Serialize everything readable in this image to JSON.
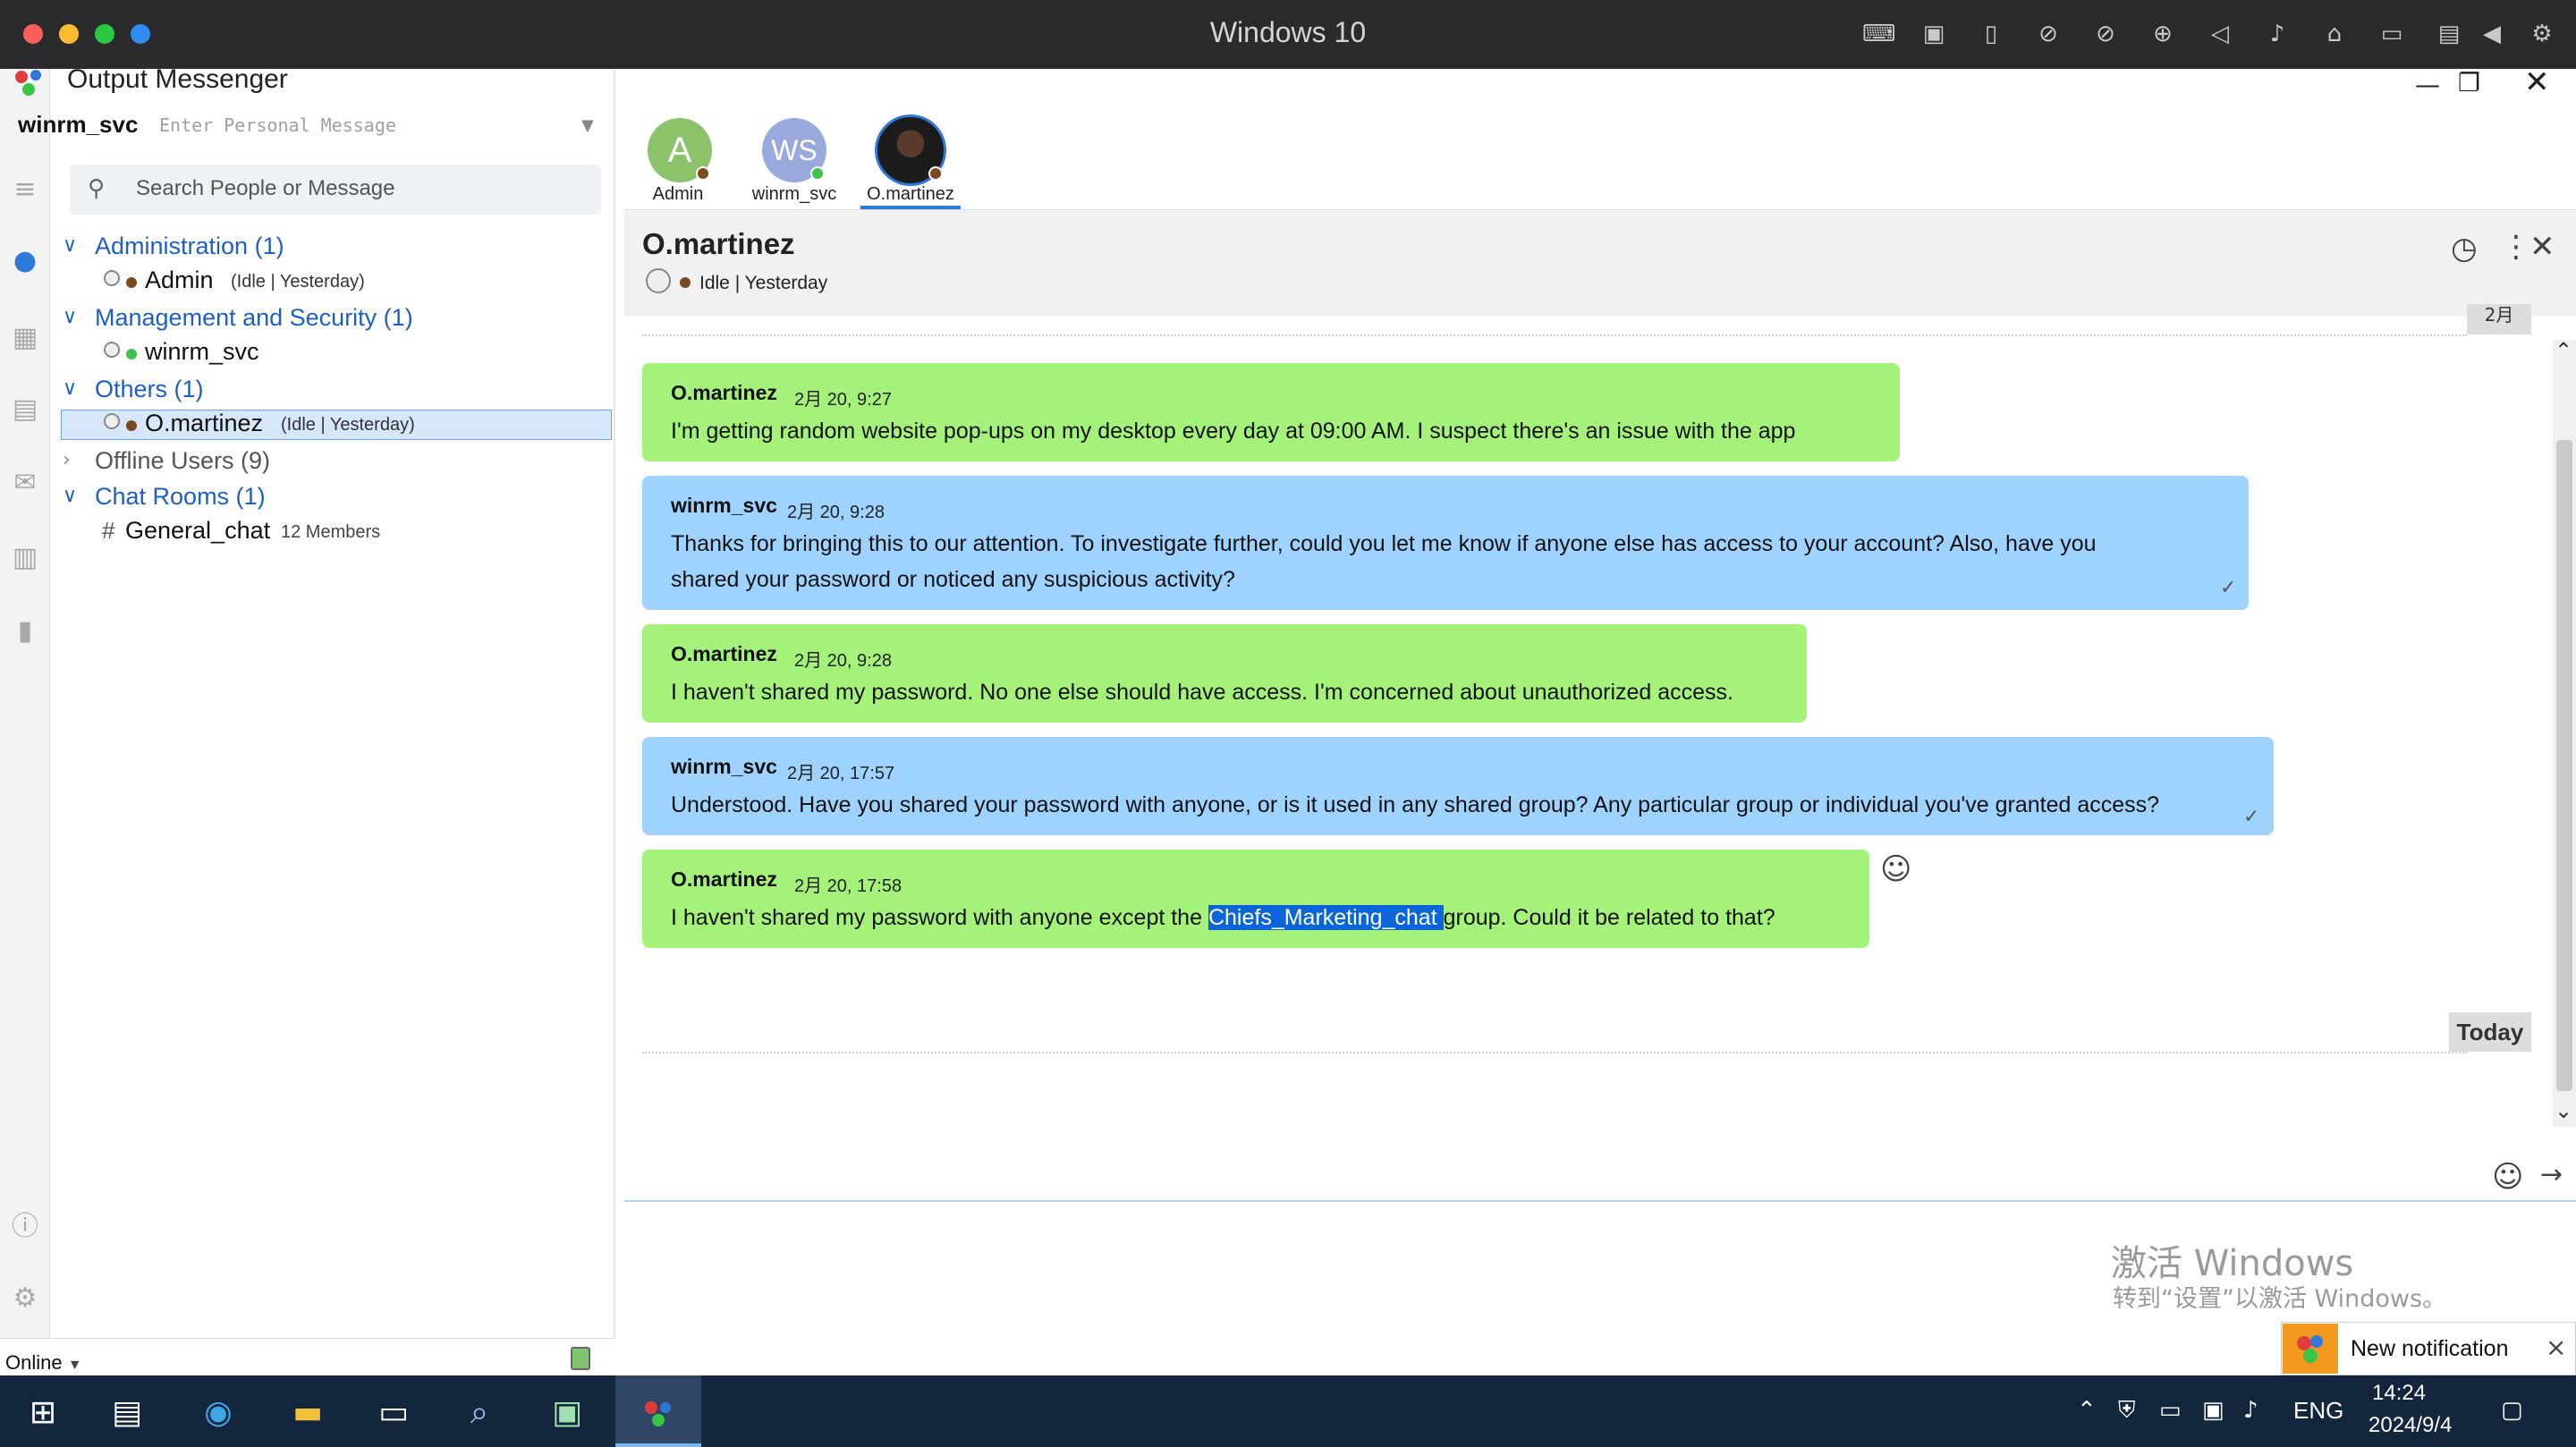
{
  "host": {
    "title": "Windows 10",
    "traffic_lights": [
      "#ff5f57",
      "#febc2e",
      "#28c840",
      "#2e8cf0"
    ]
  },
  "app": {
    "title": "Output Messenger",
    "me": {
      "name": "winrm_svc",
      "personal_message_placeholder": "Enter Personal Message"
    },
    "search_placeholder": "Search People or Message",
    "groups": [
      {
        "label": "Administration (1)",
        "users": [
          {
            "name": "Admin",
            "status": "(Idle  | Yesterday)"
          }
        ]
      },
      {
        "label": "Management and Security (1)",
        "users": [
          {
            "name": "winrm_svc",
            "status": ""
          }
        ]
      },
      {
        "label": "Others (1)",
        "users": [
          {
            "name": "O.martinez",
            "status": "(Idle  | Yesterday)"
          }
        ]
      },
      {
        "label": "Offline Users (9)",
        "users": []
      },
      {
        "label": "Chat Rooms (1)",
        "rooms": [
          {
            "name": "General_chat",
            "members": "12 Members"
          }
        ]
      }
    ],
    "presence": "Online",
    "colors": {
      "accent": "#1f5fc4",
      "online": "#3cc34a",
      "idle": "#7a4a1e",
      "green_bubble": "#a5f27a",
      "blue_bubble": "#9fd3ff"
    }
  },
  "tabs": [
    {
      "label": "Admin",
      "initial": "A",
      "color": "#8cc26a"
    },
    {
      "label": "winrm_svc",
      "initial": "WS",
      "color": "#9aa9dc"
    },
    {
      "label": "O.martinez",
      "initial": "",
      "color": "#2a2a2a"
    }
  ],
  "chat": {
    "contact": "O.martinez",
    "contact_status": "Idle | Yesterday",
    "month_tag": "2月",
    "messages": [
      {
        "sender": "O.martinez",
        "time": "2月 20, 9:27",
        "lines": [
          "I'm getting random website pop-ups on my desktop every day at 09:00 AM. I suspect there's an issue with the app"
        ]
      },
      {
        "sender": "winrm_svc",
        "time": "2月 20, 9:28",
        "lines": [
          "Thanks for bringing this to our attention. To investigate further, could you let me know if anyone else has access to your account? Also, have you",
          "shared your password or noticed any suspicious activity?"
        ]
      },
      {
        "sender": "O.martinez",
        "time": "2月 20, 9:28",
        "lines": [
          "I haven't shared my password. No one else should have access. I'm concerned about unauthorized access."
        ]
      },
      {
        "sender": "winrm_svc",
        "time": "2月 20, 17:57",
        "lines": [
          "Understood. Have you shared your password with anyone, or is it used in any shared group? Any particular group or individual you've granted access?"
        ]
      },
      {
        "sender": "O.martinez",
        "time": "2月 20, 17:58",
        "pre": "I haven't shared my password with anyone except the ",
        "highlight": "Chiefs_Marketing_chat ",
        "post": "group. Could it be related to that?"
      }
    ],
    "today_label": "Today"
  },
  "watermark": {
    "line1": "激活 Windows",
    "line2": "转到“设置”以激活 Windows。"
  },
  "notification": "New notification",
  "taskbar": {
    "lang": "ENG",
    "time": "14:24",
    "date": "2024/9/4"
  }
}
